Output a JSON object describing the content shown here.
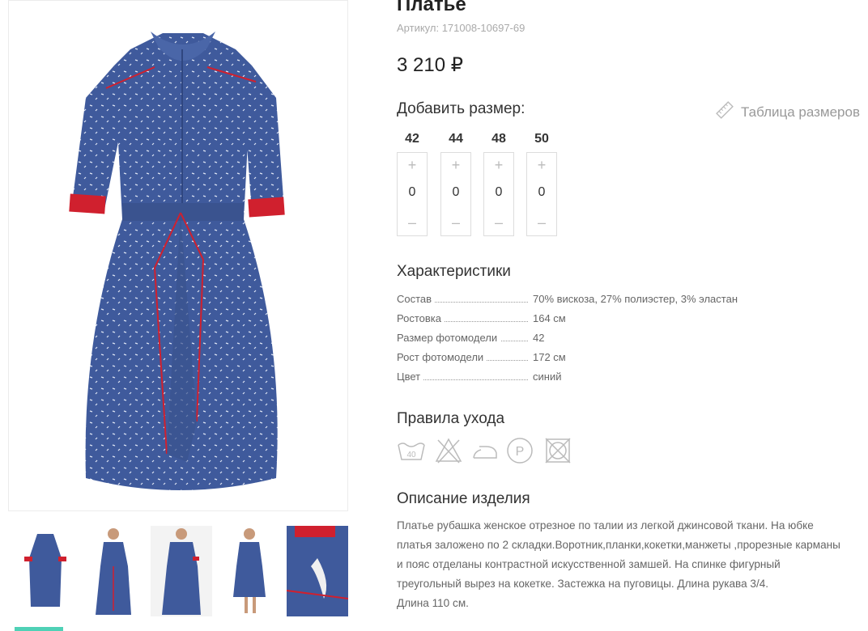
{
  "product": {
    "title": "Платье",
    "sku": "Артикул: 171008-10697-69",
    "price": "3 210 ₽"
  },
  "sizes_block": {
    "heading": "Добавить размер:",
    "size_table_link": "Таблица размеров",
    "plus_symbol": "+",
    "minus_symbol": "–",
    "sizes": [
      {
        "label": "42",
        "qty": "0"
      },
      {
        "label": "44",
        "qty": "0"
      },
      {
        "label": "48",
        "qty": "0"
      },
      {
        "label": "50",
        "qty": "0"
      }
    ]
  },
  "characteristics": {
    "heading": "Характеристики",
    "rows": [
      {
        "name": "Состав",
        "value": "70% вискоза, 27% полиэстер, 3% эластан"
      },
      {
        "name": "Ростовка",
        "value": "164 см"
      },
      {
        "name": "Размер фотомодели",
        "value": "42"
      },
      {
        "name": "Рост фотомодели",
        "value": "172 см"
      },
      {
        "name": "Цвет",
        "value": "синий"
      }
    ]
  },
  "care": {
    "heading": "Правила ухода",
    "icons": [
      "wash-40-icon",
      "no-bleach-icon",
      "iron-icon",
      "dry-clean-p-icon",
      "no-tumble-dry-icon"
    ],
    "wash_temp": "40",
    "dryclean_letter": "P"
  },
  "description": {
    "heading": "Описание изделия",
    "lines": [
      "Платье рубашка женское отрезное по талии из легкой джинсовой ткани. На юбке",
      "платья заложено по 2 складки.Воротник,планки,кокетки,манжеты ,прорезные карманы",
      "и пояс отделаны контрастной искусственной замшей. На спинке фигурный",
      "треугольный вырез на кокетке. Застежка на пуговицы. Длина рукава 3/4.",
      "Длина 110 см."
    ]
  },
  "colors": {
    "dress_blue": "#3f5a9c",
    "trim_red": "#d0202e",
    "accent_teal": "#4fd1b6",
    "icon_grey": "#bbbbbb"
  }
}
